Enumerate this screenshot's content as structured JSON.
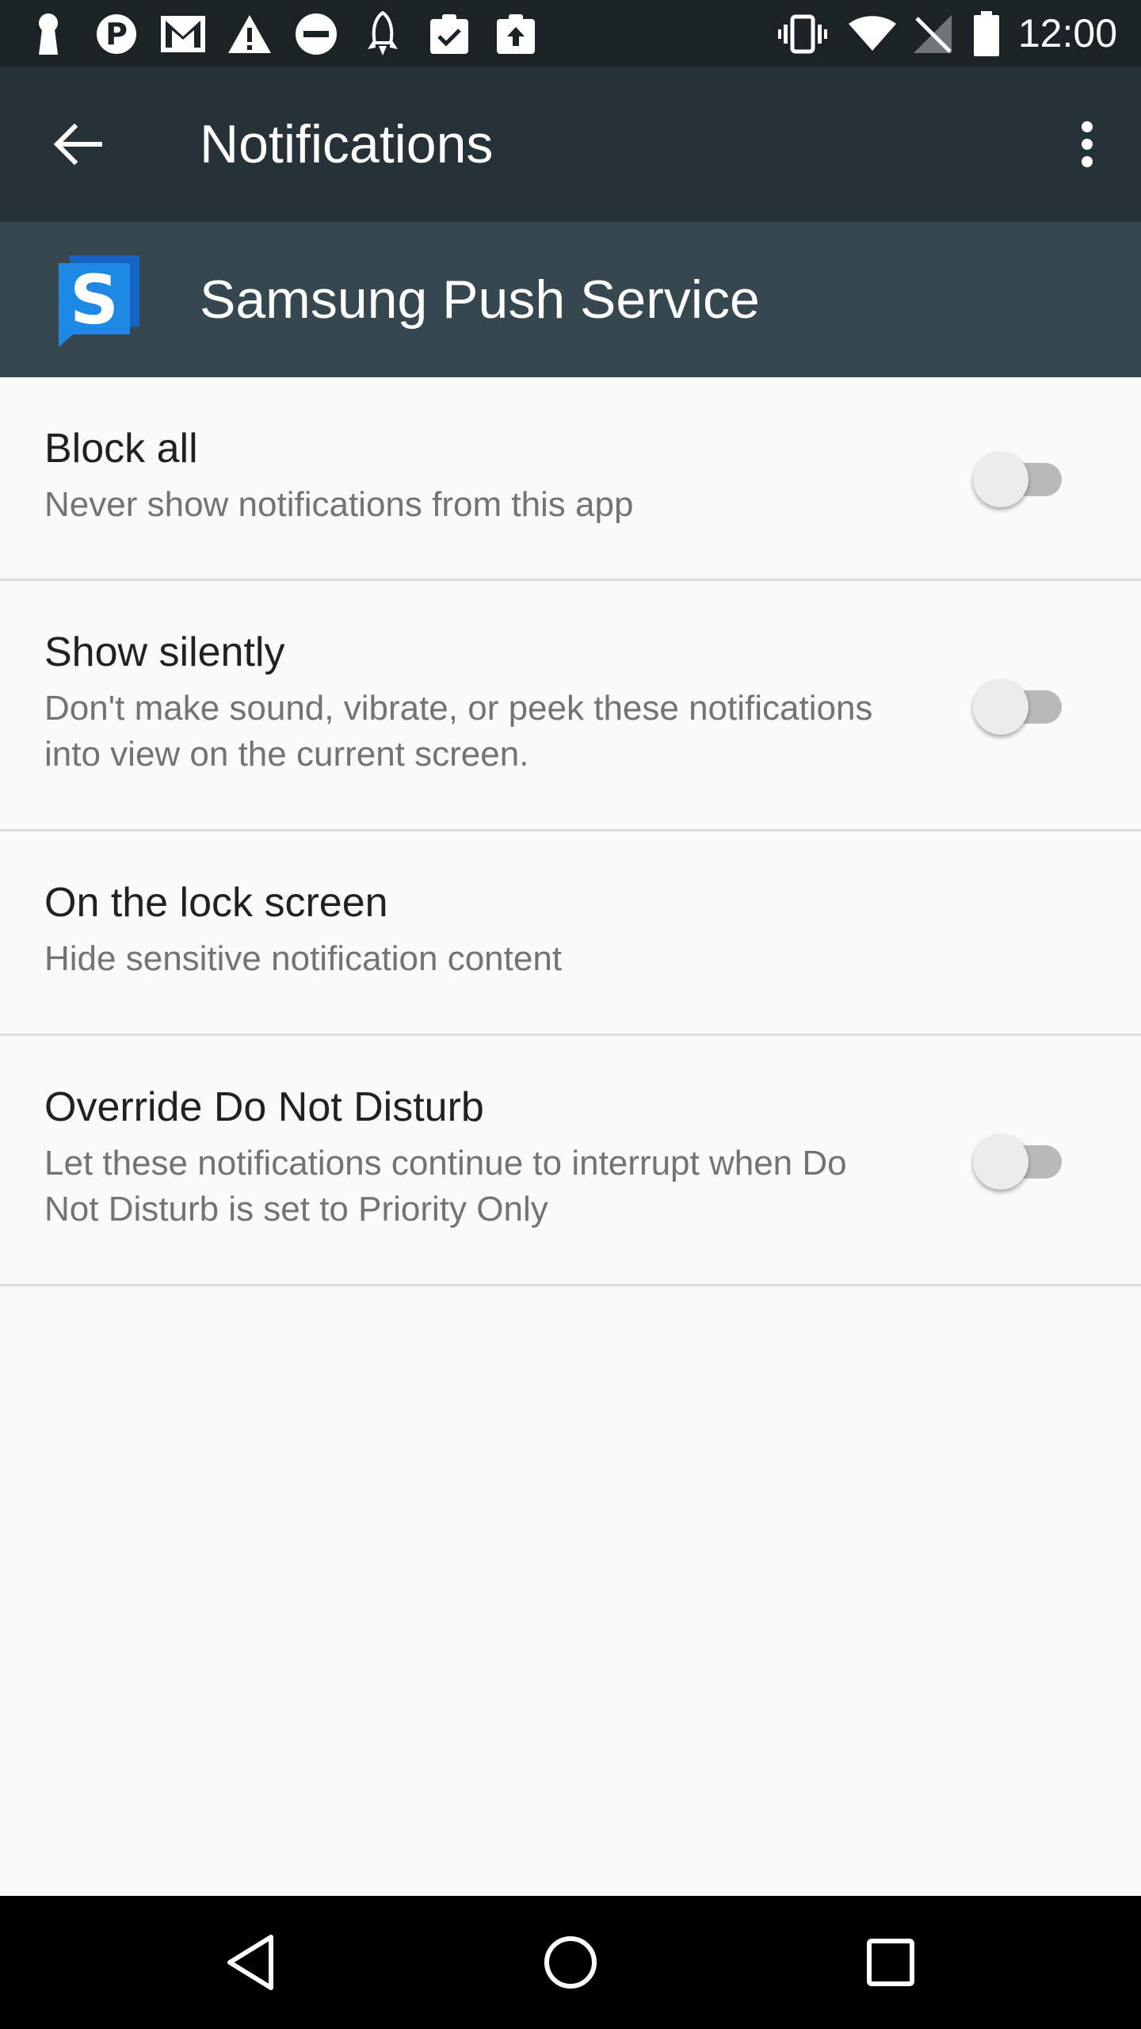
{
  "status_bar": {
    "time": "12:00",
    "left_icons": [
      "keyhole-icon",
      "pinterest-icon",
      "gmail-icon",
      "warning-icon",
      "do-not-disturb-icon",
      "rocket-icon",
      "clipboard-check-icon",
      "clipboard-upload-icon"
    ],
    "right_icons": [
      "vibrate-icon",
      "wifi-icon",
      "no-signal-icon",
      "battery-icon"
    ]
  },
  "toolbar": {
    "title": "Notifications",
    "back_icon": "arrow-back-icon",
    "overflow_icon": "more-vert-icon"
  },
  "app_header": {
    "name": "Samsung Push Service",
    "icon": "samsung-push-service-icon",
    "icon_letter": "S"
  },
  "settings": [
    {
      "title": "Block all",
      "subtitle": "Never show notifications from this app",
      "toggle": false
    },
    {
      "title": "Show silently",
      "subtitle": "Don't make sound, vibrate, or peek these notifications into view on the current screen.",
      "toggle": false
    },
    {
      "title": "On the lock screen",
      "subtitle": "Hide sensitive notification content"
    },
    {
      "title": "Override Do Not Disturb",
      "subtitle": "Let these notifications continue to interrupt when Do Not Disturb is set to Priority Only",
      "toggle": false
    }
  ],
  "nav_bar": {
    "buttons": [
      "back-triangle-icon",
      "home-circle-icon",
      "recents-square-icon"
    ]
  },
  "colors": {
    "status_bar": "#1b2327",
    "toolbar": "#263238",
    "app_header": "#37474f",
    "background": "#fafafa",
    "app_icon_blue": "#1e88e5"
  }
}
